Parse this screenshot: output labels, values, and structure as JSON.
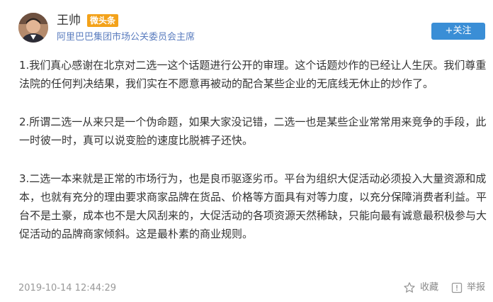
{
  "header": {
    "author_name": "王帅",
    "badge_label": "微头条",
    "author_title": "阿里巴巴集团市场公关委员会主席",
    "follow_label": "+关注",
    "accent_color": "#3a8ed6",
    "badge_color": "#f3a21a",
    "avatar_icon": "avatar-photo"
  },
  "post": {
    "paragraphs": [
      "1.我们真心感谢在北京对二选一这个话题进行公开的审理。这个话题炒作的已经让人生厌。我们尊重法院的任何判决结果，我们实在不愿意再被动的配合某些企业的无底线无休止的炒作了。",
      "2.所谓二选一从来只是一个伪命题，如果大家没记错，二选一也是某些企业常常用来竞争的手段，此一时彼一时，真可以说变脸的速度比脱裤子还快。",
      "3.二选一本来就是正常的市场行为，也是良币驱逐劣币。平台为组织大促活动必须投入大量资源和成本，也就有充分的理由要求商家品牌在货品、价格等方面具有对等力度，以充分保障消费者利益。平台不是土豪，成本也不是大风刮来的，大促活动的各项资源天然稀缺，只能向最有诚意最积极参与大促活动的品牌商家倾斜。这是最朴素的商业规则。"
    ]
  },
  "footer": {
    "timestamp": "2019-10-14 12:44:29",
    "collect_label": "收藏",
    "report_label": "举报",
    "collect_icon": "star-icon",
    "report_icon": "report-icon"
  }
}
